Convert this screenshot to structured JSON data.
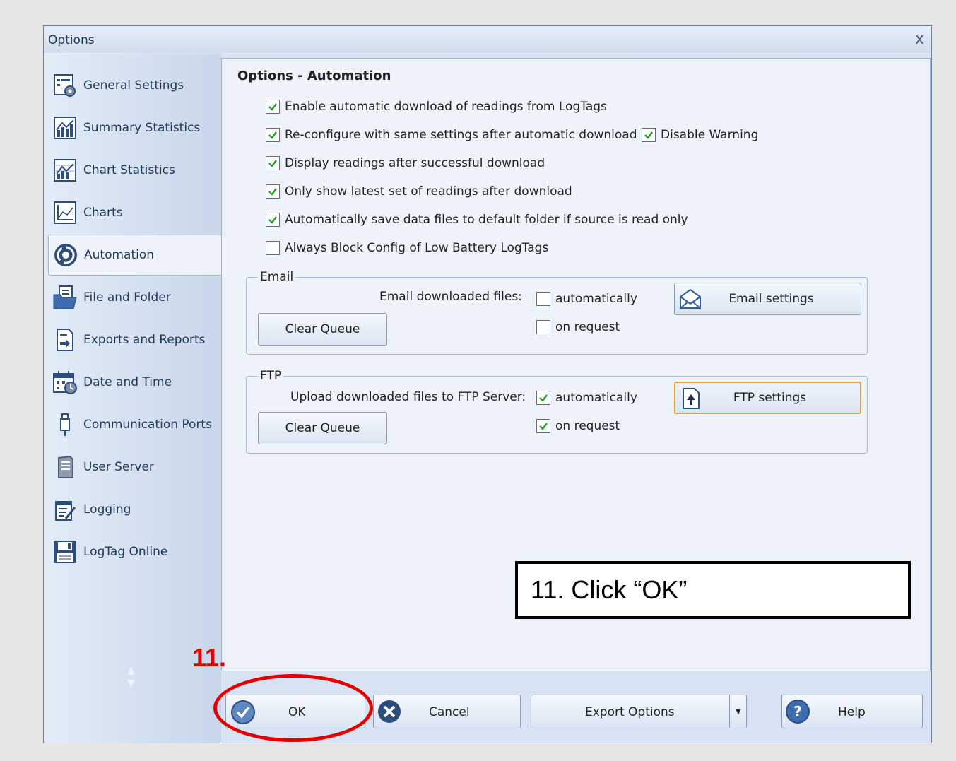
{
  "window": {
    "title": "Options",
    "close_glyph": "x"
  },
  "sidebar": {
    "items": [
      {
        "label": "General Settings",
        "icon": "general-settings-icon"
      },
      {
        "label": "Summary Statistics",
        "icon": "summary-statistics-icon"
      },
      {
        "label": "Chart Statistics",
        "icon": "chart-statistics-icon"
      },
      {
        "label": "Charts",
        "icon": "charts-icon"
      },
      {
        "label": "Automation",
        "icon": "automation-icon",
        "selected": true
      },
      {
        "label": "File and Folder",
        "icon": "folder-icon"
      },
      {
        "label": "Exports and Reports",
        "icon": "export-icon"
      },
      {
        "label": "Date and Time",
        "icon": "calendar-icon"
      },
      {
        "label": "Communication Ports",
        "icon": "usb-icon"
      },
      {
        "label": "User Server",
        "icon": "server-icon"
      },
      {
        "label": "Logging",
        "icon": "logging-icon"
      },
      {
        "label": "LogTag Online",
        "icon": "save-icon"
      }
    ]
  },
  "main": {
    "title": "Options - Automation",
    "options": [
      {
        "label": "Enable automatic download of readings from LogTags",
        "checked": true
      },
      {
        "label": "Re-configure with same settings after automatic download",
        "checked": true
      },
      {
        "label": "Display readings after successful download",
        "checked": true
      },
      {
        "label": "Only show latest set of readings after download",
        "checked": true
      },
      {
        "label": "Automatically save data files to default folder if source is read only",
        "checked": true
      },
      {
        "label": "Always Block Config of Low Battery LogTags",
        "checked": false
      }
    ],
    "disable_warning": {
      "label": "Disable Warning",
      "checked": true
    },
    "email": {
      "legend": "Email",
      "label": "Email downloaded files:",
      "automatically": {
        "label": "automatically",
        "checked": false
      },
      "on_request": {
        "label": "on request",
        "checked": false
      },
      "settings_button": "Email settings",
      "clear_queue": "Clear Queue"
    },
    "ftp": {
      "legend": "FTP",
      "label": "Upload downloaded files to FTP Server:",
      "automatically": {
        "label": "automatically",
        "checked": true
      },
      "on_request": {
        "label": "on request",
        "checked": true
      },
      "settings_button": "FTP settings",
      "clear_queue": "Clear Queue"
    }
  },
  "footer": {
    "ok": "OK",
    "cancel": "Cancel",
    "export_options": "Export Options",
    "help": "Help"
  },
  "annotation": {
    "callout": "11. Click “OK”",
    "step": "11."
  },
  "colors": {
    "accent_red": "#e40000",
    "text_dark": "#1e395b"
  }
}
